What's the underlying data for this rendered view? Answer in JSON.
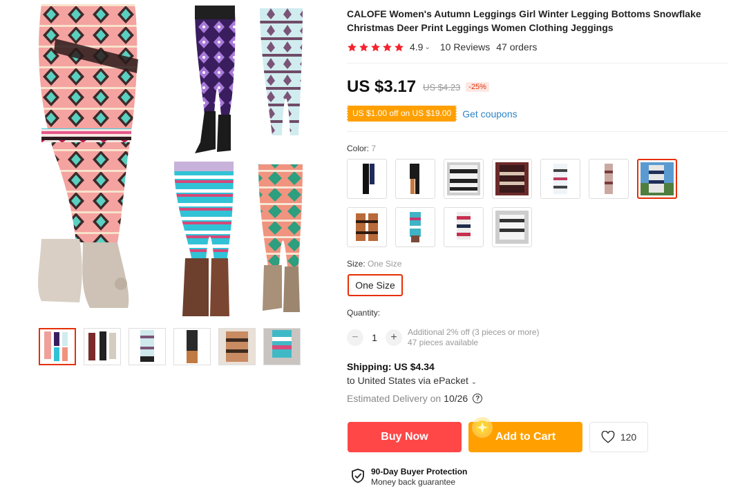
{
  "product": {
    "title": "CALOFE Women's Autumn Leggings Girl Winter Legging Bottoms Snowflake Christmas Deer Print Leggings Women Clothing Jeggings",
    "rating": "4.9",
    "reviews": "10 Reviews",
    "orders": "47 orders",
    "price": "US $3.17",
    "old_price": "US $4.23",
    "discount": "-25%",
    "coupon": "US $1.00 off on US $19.00",
    "get_coupons": "Get coupons"
  },
  "color": {
    "label": "Color:",
    "selected": "7",
    "swatch_count": 11,
    "selected_index": 6
  },
  "size": {
    "label": "Size:",
    "selected": "One Size",
    "option": "One Size"
  },
  "quantity": {
    "label": "Quantity:",
    "minus": "−",
    "value": "1",
    "plus": "+",
    "additional": "Additional 2% off (3 pieces or more)",
    "available": "47 pieces available"
  },
  "shipping": {
    "title": "Shipping: US $4.34",
    "to": "to United States via ePacket",
    "delivery_label": "Estimated Delivery on",
    "delivery_date": "10/26",
    "help": "?"
  },
  "actions": {
    "buy_now": "Buy Now",
    "add_to_cart": "Add to Cart",
    "wishlist_count": "120"
  },
  "protection": {
    "title": "90-Day Buyer Protection",
    "subtitle": "Money back guarantee"
  },
  "colors": {
    "red": "#e62e04",
    "buy": "#ff4747",
    "cart": "#ffa000",
    "star": "#f5222d",
    "link": "#2e83c5"
  },
  "icons": [
    "star-icon",
    "chevron-down-icon",
    "heart-icon",
    "shield-check-icon",
    "help-circle-icon",
    "sparkle-icon"
  ]
}
